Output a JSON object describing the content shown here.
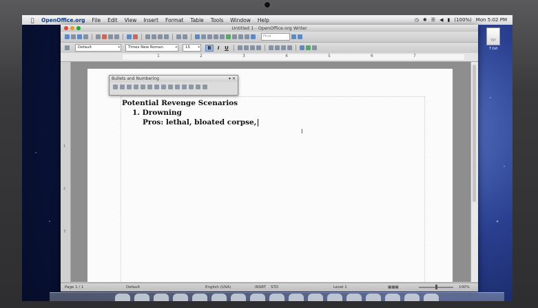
{
  "menubar": {
    "app_name": "OpenOffice.org",
    "items": [
      "File",
      "Edit",
      "View",
      "Insert",
      "Format",
      "Table",
      "Tools",
      "Window",
      "Help"
    ],
    "battery": "(100%)",
    "clock": "Mon 5:02 PM"
  },
  "desktop": {
    "file_label": "7.txt",
    "file_ext": "TXT"
  },
  "window": {
    "title": "Untitled 1 - OpenOffice.org Writer"
  },
  "toolbar": {
    "find_placeholder": "Find",
    "paragraph_style": "Default",
    "font_name": "Times New Roman",
    "font_size": "15",
    "bold_label": "B",
    "italic_label": "I",
    "underline_label": "U"
  },
  "ruler": {
    "numbers": [
      "1",
      "2",
      "3",
      "4",
      "5",
      "6",
      "7"
    ]
  },
  "vertical_ruler": {
    "numbers": [
      "1",
      "2",
      "3"
    ]
  },
  "panel": {
    "title": "Bullets and Numbering"
  },
  "document": {
    "heading": "Potential Revenge Scenarios",
    "list_item_1": "1.  Drowning",
    "list_item_1_sub": "Pros: lethal, bloated corpse,"
  },
  "statusbar": {
    "page": "Page 1 / 1",
    "style": "Default",
    "language": "English (USA)",
    "mode": "INSRT",
    "selection": "STD",
    "level": "Level 1",
    "zoom": "100%"
  },
  "colors": {
    "bold_active": "#9db4d9",
    "app_name": "#0b3d91"
  }
}
